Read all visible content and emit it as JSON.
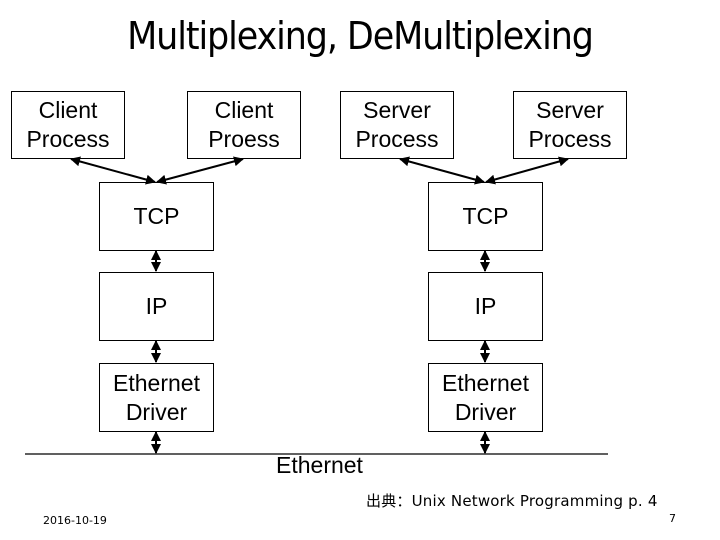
{
  "slide": {
    "title": "Multiplexing, DeMultiplexing",
    "processes": [
      {
        "label": "Client\nProcess"
      },
      {
        "label": "Client\nProess"
      },
      {
        "label": "Server\nProcess"
      },
      {
        "label": "Server\nProcess"
      }
    ],
    "stacks": [
      {
        "side": "left",
        "layers": [
          "TCP",
          "IP",
          "Ethernet\nDriver"
        ]
      },
      {
        "side": "right",
        "layers": [
          "TCP",
          "IP",
          "Ethernet\nDriver"
        ]
      }
    ],
    "network_label": "Ethernet",
    "source": "出典：Unix Network Programming p. 4",
    "date": "2016-10-19",
    "page_number": "7"
  }
}
